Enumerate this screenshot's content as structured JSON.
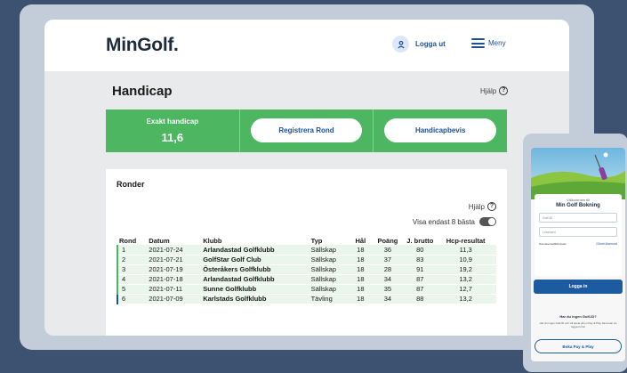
{
  "header": {
    "logo": "MinGolf.",
    "login_label": "Logga ut",
    "menu_label": "Meny"
  },
  "page": {
    "title": "Handicap",
    "help_label": "Hjälp"
  },
  "handicap": {
    "label": "Exakt handicap",
    "value": "11,6",
    "register_button": "Registrera Rond",
    "certificate_button": "Handicapbevis"
  },
  "ronder": {
    "title": "Ronder",
    "help_label": "Hjälp",
    "show_best_label": "Visa endast 8 bästa",
    "show_best_enabled": false,
    "columns": [
      "Rond",
      "Datum",
      "Klubb",
      "Typ",
      "Hål",
      "Poäng",
      "J. brutto",
      "Hcp-resultat"
    ],
    "rows": [
      {
        "rond": "1",
        "datum": "2021-07-24",
        "klubb": "Arlandastad Golfklubb",
        "typ": "Sällskap",
        "hal": "18",
        "poang": "36",
        "brutto": "80",
        "hcp": "11,3"
      },
      {
        "rond": "2",
        "datum": "2021-07-21",
        "klubb": "GolfStar Golf Club",
        "typ": "Sällskap",
        "hal": "18",
        "poang": "37",
        "brutto": "83",
        "hcp": "10,9"
      },
      {
        "rond": "3",
        "datum": "2021-07-19",
        "klubb": "Österåkers Golfklubb",
        "typ": "Sällskap",
        "hal": "18",
        "poang": "28",
        "brutto": "91",
        "hcp": "19,2"
      },
      {
        "rond": "4",
        "datum": "2021-07-18",
        "klubb": "Arlandastad Golfklubb",
        "typ": "Sällskap",
        "hal": "18",
        "poang": "34",
        "brutto": "87",
        "hcp": "13,2"
      },
      {
        "rond": "5",
        "datum": "2021-07-11",
        "klubb": "Sunne Golfklubb",
        "typ": "Sällskap",
        "hal": "18",
        "poang": "35",
        "brutto": "87",
        "hcp": "12,7"
      },
      {
        "rond": "6",
        "datum": "2021-07-09",
        "klubb": "Karlstads Golfklubb",
        "typ": "Tävling",
        "hal": "18",
        "poang": "34",
        "brutto": "88",
        "hcp": "13,2"
      }
    ]
  },
  "phone": {
    "welcome": "Välkommen till",
    "title": "Min Golf Bokning",
    "golf_id_placeholder": "Golf-ID",
    "password_placeholder": "Lösenord",
    "sponsor_text": "Svenska Golfförbundet",
    "forgot_label": "Glömt lösenord",
    "login_button": "Logga in",
    "no_id_heading": "Har du ingen Golf-ID?",
    "no_id_text": "Har du ingen Golf-ID och vill spela på en Pay & Play bana kan du logga in här",
    "book_button": "Boka Pay & Play"
  },
  "colors": {
    "brand_green": "#4cb660",
    "brand_blue": "#1c4f9a",
    "background": "#3d5270"
  }
}
